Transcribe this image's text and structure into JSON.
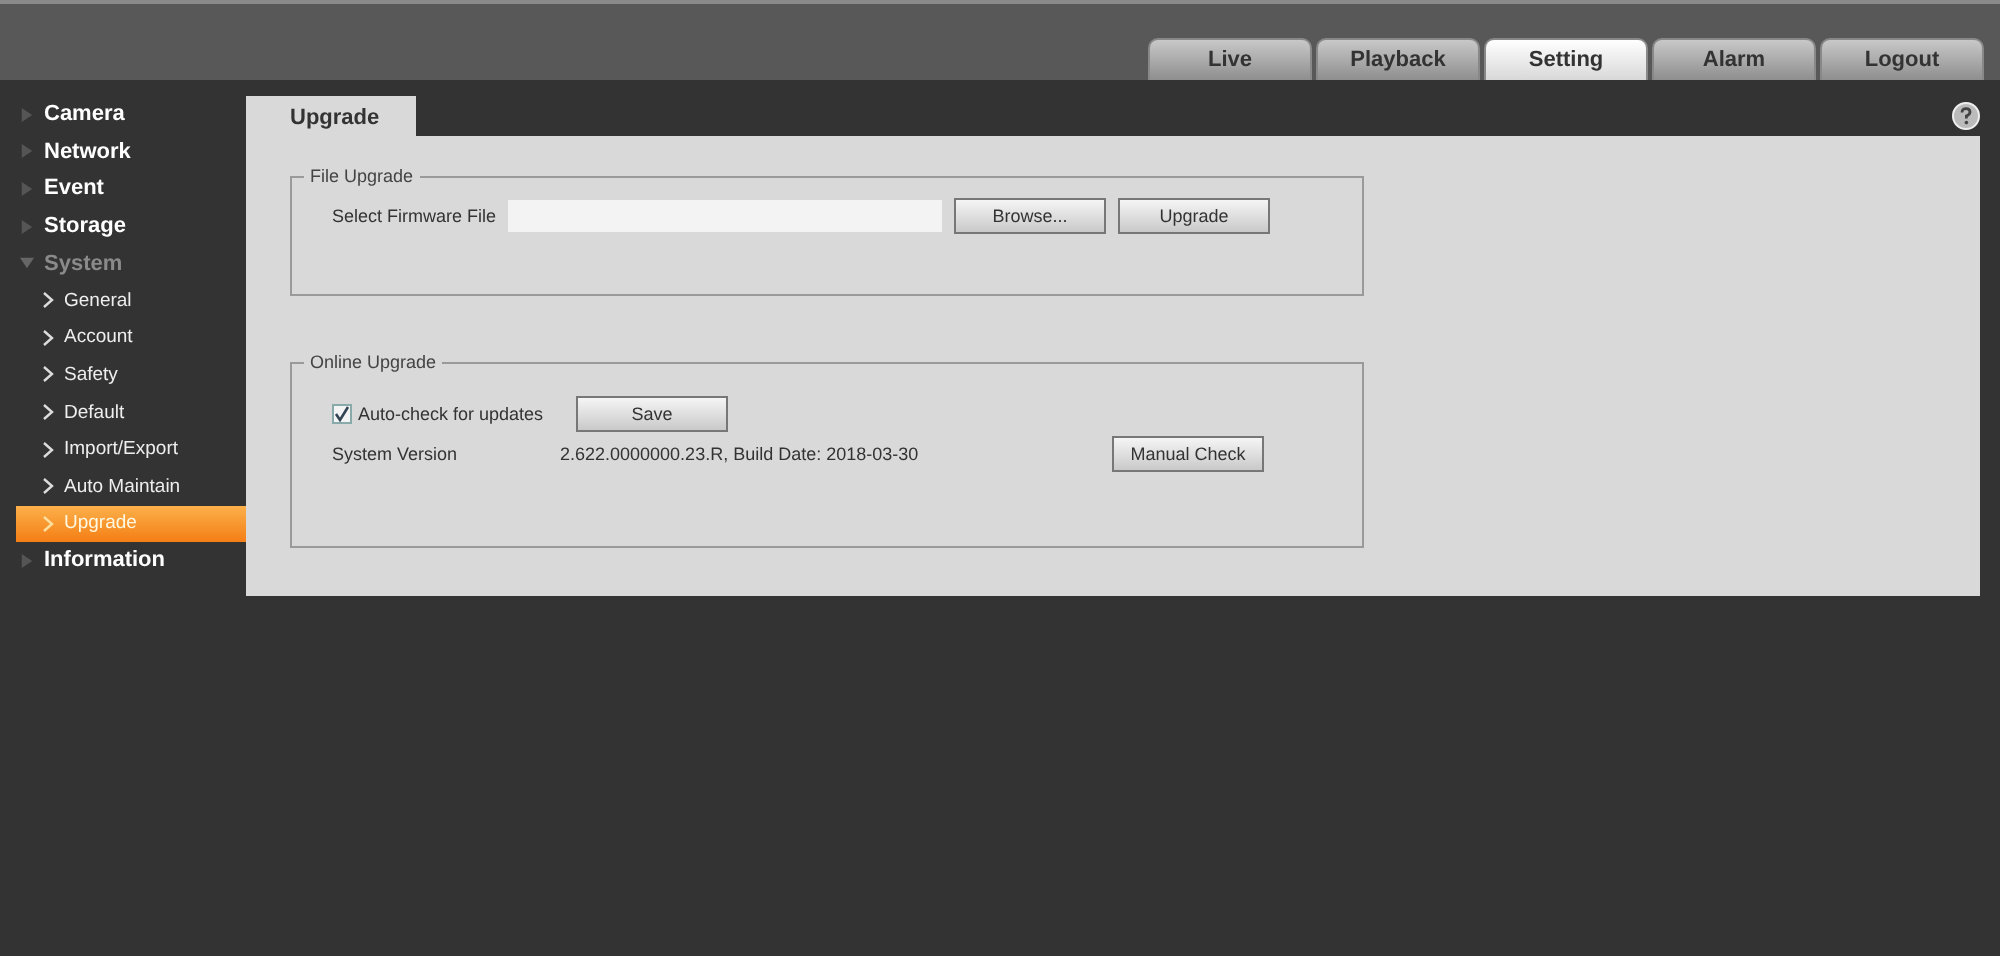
{
  "nav_tabs": [
    {
      "label": "Live",
      "selected": false
    },
    {
      "label": "Playback",
      "selected": false
    },
    {
      "label": "Setting",
      "selected": true
    },
    {
      "label": "Alarm",
      "selected": false
    },
    {
      "label": "Logout",
      "selected": false
    }
  ],
  "sidebar": {
    "items": [
      {
        "label": "Camera",
        "expanded": false
      },
      {
        "label": "Network",
        "expanded": false
      },
      {
        "label": "Event",
        "expanded": false
      },
      {
        "label": "Storage",
        "expanded": false
      },
      {
        "label": "System",
        "expanded": true,
        "children": [
          {
            "label": "General",
            "selected": false
          },
          {
            "label": "Account",
            "selected": false
          },
          {
            "label": "Safety",
            "selected": false
          },
          {
            "label": "Default",
            "selected": false
          },
          {
            "label": "Import/Export",
            "selected": false
          },
          {
            "label": "Auto Maintain",
            "selected": false
          },
          {
            "label": "Upgrade",
            "selected": true
          }
        ]
      },
      {
        "label": "Information",
        "expanded": false
      }
    ]
  },
  "page_tab": "Upgrade",
  "file_upgrade": {
    "title": "File Upgrade",
    "label": "Select Firmware File",
    "browse_button": "Browse...",
    "upgrade_button": "Upgrade"
  },
  "online_upgrade": {
    "title": "Online Upgrade",
    "auto_check": {
      "label": "Auto-check for updates",
      "checked": true
    },
    "save_button": "Save",
    "version_label": "System Version",
    "version_value": "2.622.0000000.23.R, Build Date: 2018-03-30",
    "manual_check_button": "Manual Check"
  }
}
